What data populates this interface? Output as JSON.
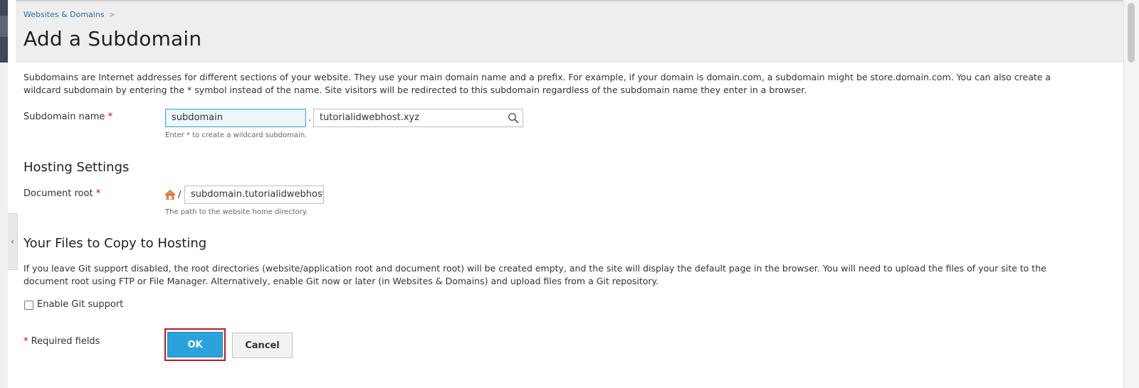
{
  "breadcrumb": {
    "item": "Websites & Domains",
    "separator": ">"
  },
  "page": {
    "title": "Add a Subdomain"
  },
  "intro": "Subdomains are Internet addresses for different sections of your website. They use your main domain name and a prefix. For example, if your domain is domain.com, a subdomain might be store.domain.com. You can also create a wildcard subdomain by entering the * symbol instead of the name. Site visitors will be redirected to this subdomain regardless of the subdomain name they enter in a browser.",
  "subdomain": {
    "label": "Subdomain name",
    "required_mark": "*",
    "name_value": "subdomain",
    "dot": ".",
    "domain_value": "tutorialidwebhost.xyz",
    "hint": "Enter * to create a wildcard subdomain."
  },
  "hosting": {
    "title": "Hosting Settings",
    "docroot_label": "Document root",
    "required_mark": "*",
    "slash": "/",
    "docroot_value": "subdomain.tutorialidwebhost.",
    "hint": "The path to the website home directory."
  },
  "files": {
    "title": "Your Files to Copy to Hosting",
    "description": "If you leave Git support disabled, the root directories (website/application root and document root) will be created empty, and the site will display the default page in the browser. You will need to upload the files of your site to the document root using FTP or File Manager. Alternatively, enable Git now or later (in Websites & Domains) and upload files from a Git repository.",
    "git_label": "Enable Git support"
  },
  "footer": {
    "required_mark": "*",
    "required_text": "Required fields",
    "ok_label": "OK",
    "cancel_label": "Cancel"
  },
  "icons": {
    "search": "search-icon",
    "home": "home-icon",
    "collapse": "chevron-left-icon"
  },
  "colors": {
    "accent": "#2ba2dc",
    "highlight": "#c0161e",
    "required": "#d0021b",
    "link": "#2f6f9e"
  }
}
